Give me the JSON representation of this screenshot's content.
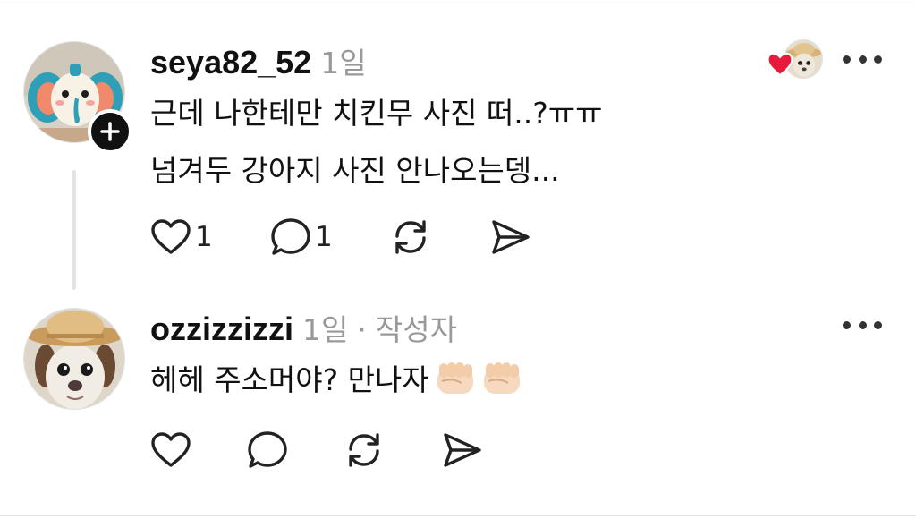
{
  "thread": [
    {
      "username": "seya82_52",
      "time": "1일",
      "author_tag": "",
      "body_lines": [
        "근데 나한테만 치킨무 사진 떠..?ㅠㅠ",
        "넘겨두 강아지 사진 안나오는뎅..."
      ],
      "emoji": [],
      "likes": "1",
      "replies": "1",
      "avatar_icon": "elephant-avatar",
      "has_follow_badge": true,
      "liked_by_author": true
    },
    {
      "username": "ozzizzizzi",
      "time": "1일",
      "separator": "·",
      "author_tag": "작성자",
      "body_lines": [
        "헤헤 주소머야? 만나자"
      ],
      "emoji": [
        "fist-emoji",
        "fist-emoji"
      ],
      "likes": "",
      "replies": "",
      "avatar_icon": "dog-with-straw-hat-avatar",
      "has_follow_badge": false,
      "liked_by_author": false
    }
  ],
  "colors": {
    "heart": "#e8193c",
    "muted_text": "#999999",
    "text": "#111111"
  }
}
